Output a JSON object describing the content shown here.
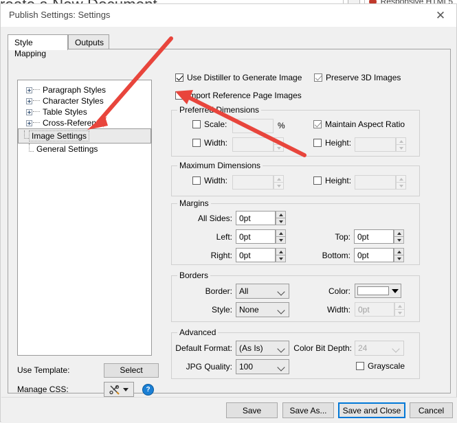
{
  "background": {
    "title": "reate a New Document",
    "right_label": "Responsive HTML5"
  },
  "dialog": {
    "title": "Publish Settings: Settings",
    "close_icon": "close-icon"
  },
  "tabs": [
    {
      "label": "Style Mapping",
      "active": true
    },
    {
      "label": "Outputs",
      "active": false
    }
  ],
  "tree": {
    "nodes": [
      {
        "label": "Paragraph Styles",
        "expandable": true,
        "selected": false
      },
      {
        "label": "Character Styles",
        "expandable": true,
        "selected": false
      },
      {
        "label": "Table Styles",
        "expandable": true,
        "selected": false
      },
      {
        "label": "Cross-Reference",
        "expandable": true,
        "selected": false
      },
      {
        "label": "Image Settings",
        "expandable": false,
        "selected": true
      },
      {
        "label": "General Settings",
        "expandable": false,
        "selected": false
      }
    ]
  },
  "left_footer": {
    "use_template_label": "Use Template:",
    "select_button": "Select",
    "manage_css_label": "Manage CSS:",
    "css_icon": "scissors-tools-icon",
    "css_dropdown_icon": "chevron-down-icon",
    "help_icon": "help-icon",
    "help_glyph": "?"
  },
  "options": {
    "use_distiller": {
      "label": "Use Distiller to Generate Image",
      "checked": true,
      "disabled": false
    },
    "preserve_3d": {
      "label": "Preserve 3D Images",
      "checked": true,
      "disabled": true
    },
    "import_reference": {
      "label": "Import Reference Page Images",
      "checked": false,
      "disabled": false
    }
  },
  "preferred_dimensions": {
    "title": "Preferred Dimensions",
    "scale": {
      "label": "Scale:",
      "checked": false,
      "value": "",
      "unit": "%"
    },
    "width": {
      "label": "Width:",
      "checked": false,
      "value": ""
    },
    "maintain_aspect_ratio": {
      "label": "Maintain Aspect Ratio",
      "checked": true,
      "disabled": true
    },
    "height": {
      "label": "Height:",
      "checked": false,
      "value": ""
    }
  },
  "maximum_dimensions": {
    "title": "Maximum Dimensions",
    "width": {
      "label": "Width:",
      "checked": false,
      "value": ""
    },
    "height": {
      "label": "Height:",
      "checked": false,
      "value": ""
    }
  },
  "margins": {
    "title": "Margins",
    "all_sides": {
      "label": "All Sides:",
      "value": "0pt"
    },
    "left": {
      "label": "Left:",
      "value": "0pt"
    },
    "right": {
      "label": "Right:",
      "value": "0pt"
    },
    "top": {
      "label": "Top:",
      "value": "0pt"
    },
    "bottom": {
      "label": "Bottom:",
      "value": "0pt"
    }
  },
  "borders": {
    "title": "Borders",
    "border": {
      "label": "Border:",
      "value": "All"
    },
    "style": {
      "label": "Style:",
      "value": "None"
    },
    "color": {
      "label": "Color:",
      "value": "#ffffff"
    },
    "width": {
      "label": "Width:",
      "value": "0pt",
      "disabled": true
    }
  },
  "advanced": {
    "title": "Advanced",
    "default_format": {
      "label": "Default Format:",
      "value": "(As Is)"
    },
    "jpg_quality": {
      "label": "JPG Quality:",
      "value": "100"
    },
    "color_bit_depth": {
      "label": "Color Bit Depth:",
      "value": "24",
      "disabled": true
    },
    "grayscale": {
      "label": "Grayscale",
      "checked": false
    }
  },
  "footer_buttons": [
    {
      "label": "Save",
      "focused": false
    },
    {
      "label": "Save As...",
      "focused": false
    },
    {
      "label": "Save and Close",
      "focused": true
    },
    {
      "label": "Cancel",
      "focused": false
    }
  ],
  "annotations": {
    "arrow_color": "#e8453c",
    "arrow1_target": "Image Settings",
    "arrow2_target": "Import Reference Page Images"
  }
}
